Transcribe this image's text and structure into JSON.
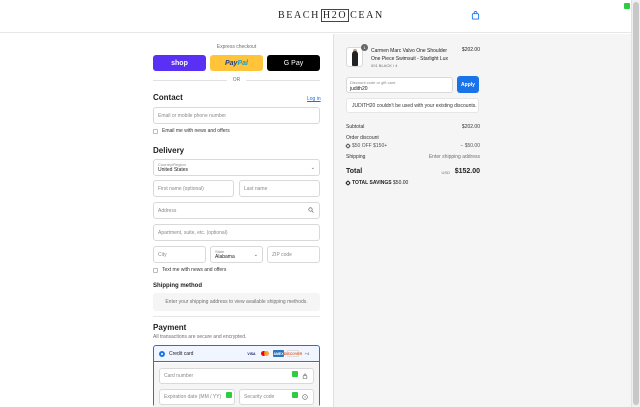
{
  "header": {
    "logo_left": "BEACH",
    "logo_mid": "H2O",
    "logo_right": "CEAN"
  },
  "express": {
    "label": "Express checkout",
    "shop_label": "shop",
    "paypal_a": "Pay",
    "paypal_b": "Pal",
    "gpay_label": "G Pay",
    "or_label": "OR"
  },
  "contact": {
    "title": "Contact",
    "login_link": "Log in",
    "email_placeholder": "Email or mobile phone number",
    "news_label": "Email me with news and offers"
  },
  "delivery": {
    "title": "Delivery",
    "country_label": "Country/Region",
    "country_value": "United States",
    "first_name": "First name (optional)",
    "last_name": "Last name",
    "address": "Address",
    "apartment": "Apartment, suite, etc. (optional)",
    "city": "City",
    "state_label": "State",
    "state_value": "Alabama",
    "zip": "ZIP code",
    "text_label": "Text me with news and offers"
  },
  "shipping": {
    "title": "Shipping method",
    "message": "Enter your shipping address to view available shipping methods."
  },
  "payment": {
    "title": "Payment",
    "subtitle": "All transactions are secure and encrypted.",
    "credit_card_label": "Credit card",
    "brands": [
      "VISA",
      "mastercard",
      "AMEX",
      "DISCOVER"
    ],
    "more_label": "+4",
    "card_number": "Card number",
    "expiration": "Expiration date (MM / YY)",
    "security_code": "Security code"
  },
  "order": {
    "quantity": "1",
    "product_name": "Carmen Marc Valvo One Shoulder One Piece Swimsuit - Starlight Lux",
    "variant": "001 BLACK / 4",
    "price": "$202.00",
    "discount_label": "Discount code or gift card",
    "discount_value": "judith20",
    "apply_label": "Apply",
    "error_message": "JUDITH20 couldn't be used with your existing discounts.",
    "subtotal_label": "Subtotal",
    "subtotal_value": "$202.00",
    "order_discount_label": "Order discount",
    "discount_code": "$50 OFF $150+",
    "discount_amount": "− $50.00",
    "shipping_label": "Shipping",
    "shipping_value": "Enter shipping address",
    "total_label": "Total",
    "currency": "USD",
    "total_value": "$152.00",
    "savings_label": "TOTAL SAVINGS",
    "savings_value": "$50.00"
  }
}
